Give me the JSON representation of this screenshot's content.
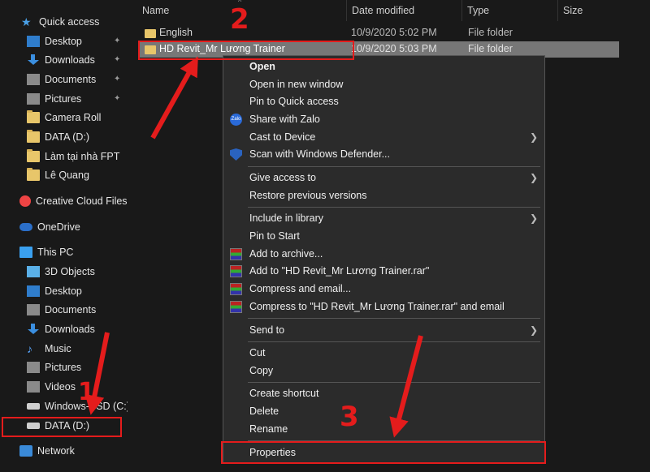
{
  "sidebar": {
    "quick_access": "Quick access",
    "items": [
      {
        "label": "Desktop",
        "pinned": true
      },
      {
        "label": "Downloads",
        "pinned": true
      },
      {
        "label": "Documents",
        "pinned": true
      },
      {
        "label": "Pictures",
        "pinned": true
      },
      {
        "label": "Camera Roll"
      },
      {
        "label": "DATA (D:)"
      },
      {
        "label": "Làm tại nhà FPT"
      },
      {
        "label": "Lê Quang"
      },
      {
        "label": "Creative Cloud Files"
      },
      {
        "label": "OneDrive"
      },
      {
        "label": "This PC"
      },
      {
        "label": "3D Objects"
      },
      {
        "label": "Desktop"
      },
      {
        "label": "Documents"
      },
      {
        "label": "Downloads"
      },
      {
        "label": "Music"
      },
      {
        "label": "Pictures"
      },
      {
        "label": "Videos"
      },
      {
        "label": "Windows-SSD (C:)"
      },
      {
        "label": "DATA (D:)"
      },
      {
        "label": "Network"
      }
    ]
  },
  "columns": {
    "name": "Name",
    "date_modified": "Date modified",
    "type": "Type",
    "size": "Size"
  },
  "files": [
    {
      "name": "English",
      "date": "10/9/2020 5:02 PM",
      "type": "File folder"
    },
    {
      "name": "HD Revit_Mr Lương Trainer",
      "date": "10/9/2020 5:03 PM",
      "type": "File folder"
    }
  ],
  "context_menu": {
    "items": [
      "Open",
      "Open in new window",
      "Pin to Quick access",
      "Share with Zalo",
      "Cast to Device",
      "Scan with Windows Defender...",
      "Give access to",
      "Restore previous versions",
      "Include in library",
      "Pin to Start",
      "Add to archive...",
      "Add to \"HD Revit_Mr Lương Trainer.rar\"",
      "Compress and email...",
      "Compress to \"HD Revit_Mr Lương Trainer.rar\" and email",
      "Send to",
      "Cut",
      "Copy",
      "Create shortcut",
      "Delete",
      "Rename",
      "Properties"
    ],
    "zalo_icon_text": "Zalo"
  },
  "annotations": {
    "step1": "1",
    "step2": "2",
    "step3": "3",
    "color": "#e41c1c"
  },
  "sort_arrow": "^",
  "submenu_arrow": "❯",
  "pin_glyph": "📌"
}
